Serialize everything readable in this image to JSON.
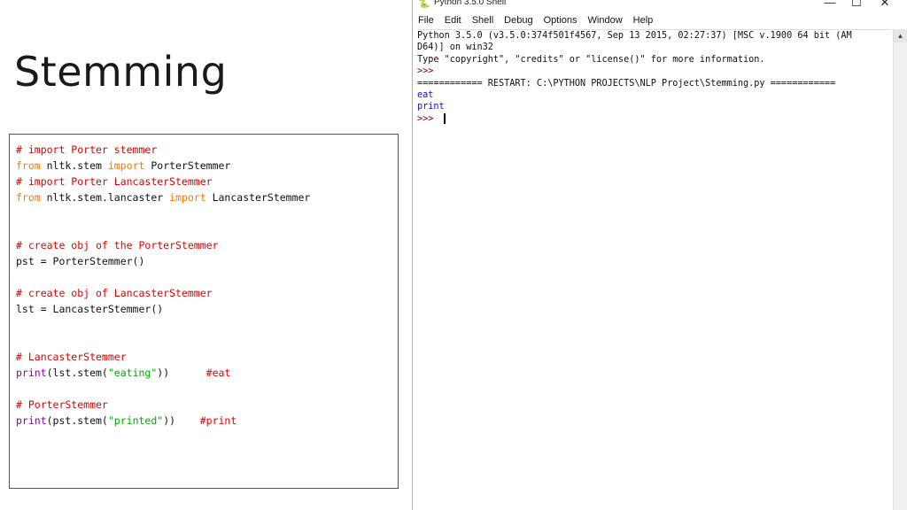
{
  "slide": {
    "title": "Stemming"
  },
  "code": {
    "lines": [
      [
        {
          "t": "# import Porter stemmer",
          "c": "comment"
        }
      ],
      [
        {
          "t": "from",
          "c": "keyword"
        },
        {
          "t": " nltk.stem ",
          "c": ""
        },
        {
          "t": "import",
          "c": "keyword"
        },
        {
          "t": " PorterStemmer",
          "c": ""
        }
      ],
      [
        {
          "t": "# import Porter LancasterStemmer",
          "c": "comment"
        }
      ],
      [
        {
          "t": "from",
          "c": "keyword"
        },
        {
          "t": " nltk.stem.lancaster ",
          "c": ""
        },
        {
          "t": "import",
          "c": "keyword"
        },
        {
          "t": " LancasterStemmer",
          "c": ""
        }
      ],
      [],
      [],
      [
        {
          "t": "# create obj of the PorterStemmer",
          "c": "comment"
        }
      ],
      [
        {
          "t": "pst = PorterStemmer()",
          "c": ""
        }
      ],
      [],
      [
        {
          "t": "# create obj of LancasterStemmer",
          "c": "comment"
        }
      ],
      [
        {
          "t": "lst = LancasterStemmer()",
          "c": ""
        }
      ],
      [],
      [],
      [
        {
          "t": "# LancasterStemmer",
          "c": "comment"
        }
      ],
      [
        {
          "t": "print",
          "c": "builtin"
        },
        {
          "t": "(lst.stem(",
          "c": ""
        },
        {
          "t": "\"eating\"",
          "c": "string"
        },
        {
          "t": "))      ",
          "c": ""
        },
        {
          "t": "#eat",
          "c": "comment"
        }
      ],
      [],
      [
        {
          "t": "# PorterStemmer",
          "c": "comment"
        }
      ],
      [
        {
          "t": "print",
          "c": "builtin"
        },
        {
          "t": "(pst.stem(",
          "c": ""
        },
        {
          "t": "\"printed\"",
          "c": "string"
        },
        {
          "t": "))    ",
          "c": ""
        },
        {
          "t": "#print",
          "c": "comment"
        }
      ]
    ]
  },
  "shell": {
    "window_title": "Python 3.5.0 Shell",
    "minimize_glyph": "—",
    "maximize_glyph": "☐",
    "close_glyph": "✕",
    "menu": [
      "File",
      "Edit",
      "Shell",
      "Debug",
      "Options",
      "Window",
      "Help"
    ],
    "lines": [
      [
        {
          "t": "Python 3.5.0 (v3.5.0:374f501f4567, Sep 13 2015, 02:27:37) [MSC v.1900 64 bit (AM",
          "c": ""
        }
      ],
      [
        {
          "t": "D64)] on win32",
          "c": ""
        }
      ],
      [
        {
          "t": "Type \"copyright\", \"credits\" or \"license()\" for more information.",
          "c": ""
        }
      ],
      [
        {
          "t": ">>> ",
          "c": "prompt"
        }
      ],
      [
        {
          "t": "============ RESTART: C:\\PYTHON PROJECTS\\NLP Project\\Stemming.py ============",
          "c": ""
        }
      ],
      [
        {
          "t": "eat",
          "c": "output"
        }
      ],
      [
        {
          "t": "print",
          "c": "output"
        }
      ],
      [
        {
          "t": ">>> ",
          "c": "prompt"
        }
      ]
    ],
    "icons": {
      "app": "python-shell-icon",
      "scroll_up": "arrow-up-icon"
    },
    "colors": {
      "prompt": "#7a0000",
      "output": "#1010dd"
    }
  }
}
